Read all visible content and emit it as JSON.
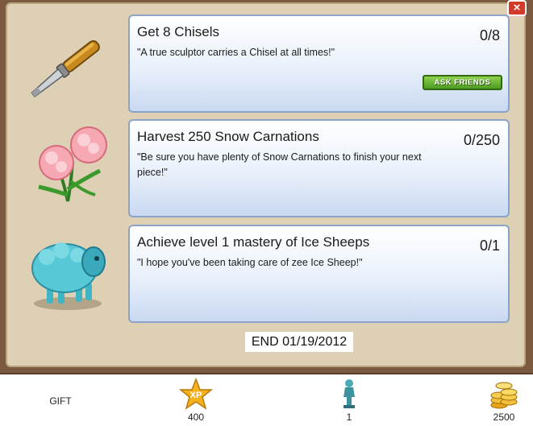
{
  "close_label": "×",
  "quests": [
    {
      "title": "Get 8 Chisels",
      "description": "\"A true sculptor carries a Chisel at all times!\"",
      "progress": "0/8",
      "icon": "chisel-icon",
      "button_label": "ASK FRIENDS"
    },
    {
      "title": "Harvest 250 Snow Carnations",
      "description": "\"Be sure you have plenty of Snow Carnations to finish your next piece!\"",
      "progress": "0/250",
      "icon": "snow-carnation-icon"
    },
    {
      "title": "Achieve level 1 mastery of Ice Sheeps",
      "description": "\"I hope you've been taking care of zee Ice Sheep!\"",
      "progress": "0/1",
      "icon": "ice-sheep-icon"
    }
  ],
  "end_date": "END 01/19/2012",
  "rewards": {
    "gift_label": "GIFT",
    "xp_icon_text": "XP",
    "xp_value": "400",
    "statue_value": "1",
    "coins_value": "2500"
  },
  "colors": {
    "frame": "#7b5a3f",
    "parchment": "#ddd0b5",
    "card_border": "#8aa3c6",
    "ask_button": "#5aa82a",
    "close_button": "#d23a2a"
  }
}
